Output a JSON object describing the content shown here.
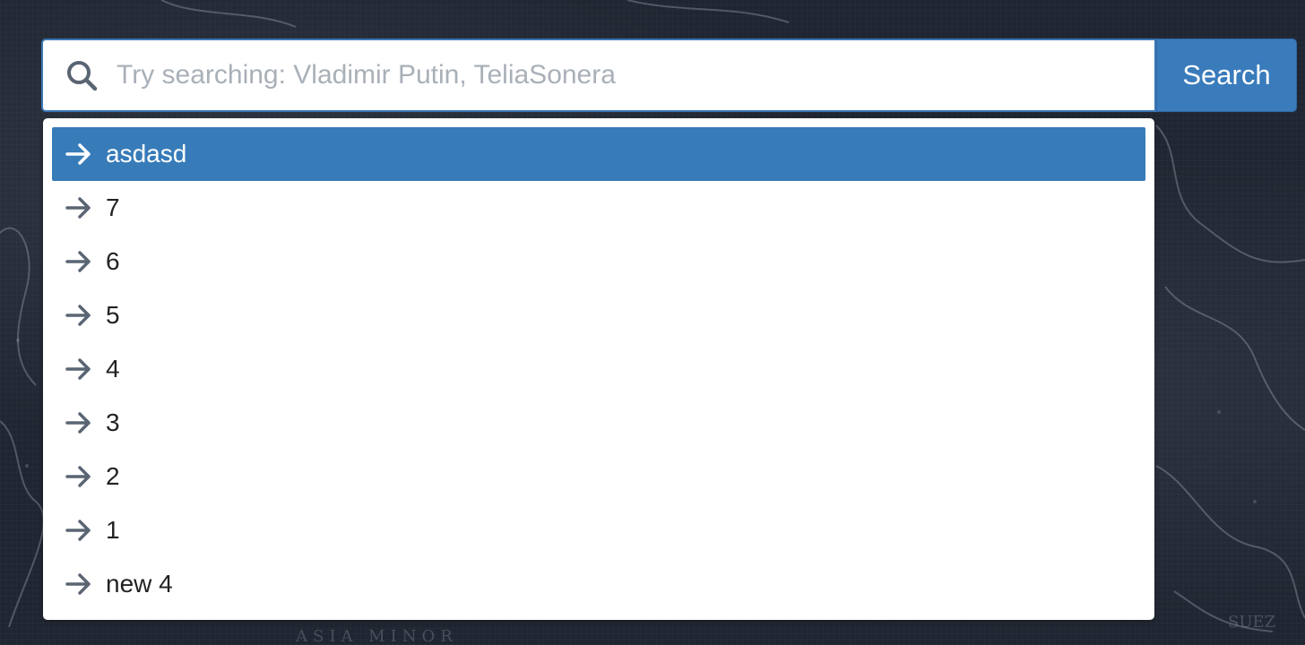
{
  "search": {
    "placeholder": "Try searching: Vladimir Putin, TeliaSonera",
    "value": "",
    "button_label": "Search",
    "icon": "search-icon"
  },
  "suggestions": {
    "icon": "arrow-right-icon",
    "active_index": 0,
    "items": [
      {
        "label": "asdasd"
      },
      {
        "label": "7"
      },
      {
        "label": "6"
      },
      {
        "label": "5"
      },
      {
        "label": "4"
      },
      {
        "label": "3"
      },
      {
        "label": "2"
      },
      {
        "label": "1"
      },
      {
        "label": "new 4"
      }
    ]
  },
  "background": {
    "map_label": "ASIA MINOR"
  },
  "colors": {
    "accent": "#377bb9",
    "background": "#202631",
    "icon_gray": "#5a6573"
  }
}
